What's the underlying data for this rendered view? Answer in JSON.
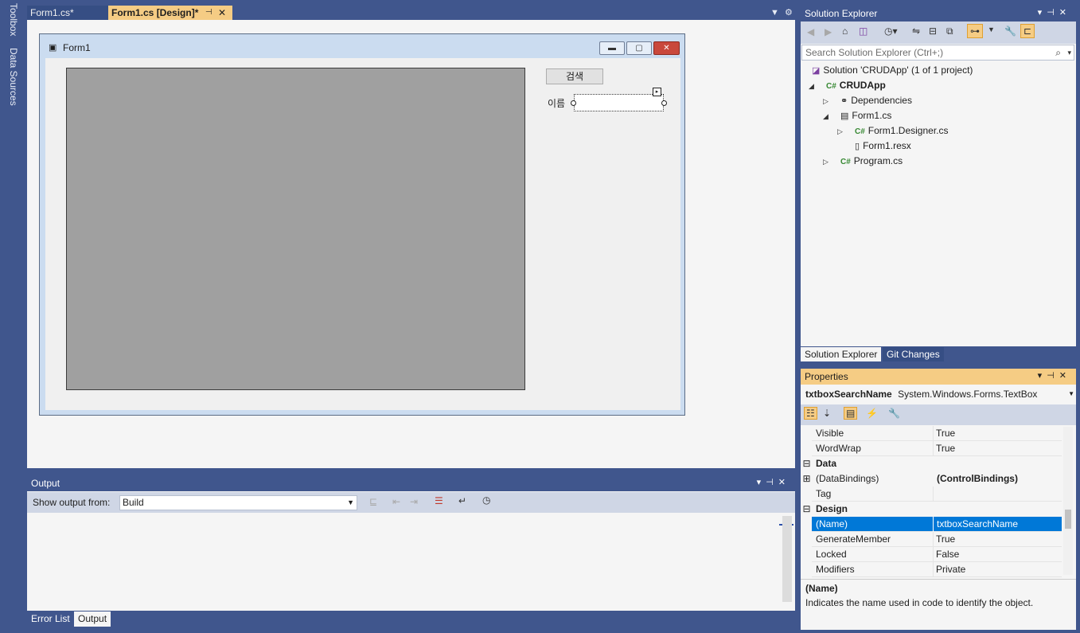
{
  "left_rail": {
    "toolbox": "Toolbox",
    "data_sources": "Data Sources"
  },
  "doc_tabs": [
    {
      "label": "Form1.cs*"
    },
    {
      "label": "Form1.cs [Design]*"
    }
  ],
  "designer": {
    "form_title": "Form1",
    "search_button": "검색",
    "name_label": "이름"
  },
  "output": {
    "title": "Output",
    "show_output_from": "Show output from:",
    "source": "Build"
  },
  "bottom_tabs": [
    "Error List",
    "Output"
  ],
  "solution_explorer": {
    "title": "Solution Explorer",
    "search_placeholder": "Search Solution Explorer (Ctrl+;)",
    "tree": [
      {
        "label": "Solution 'CRUDApp'   (1 of 1 project)"
      },
      {
        "label": "CRUDApp"
      },
      {
        "label": "Dependencies"
      },
      {
        "label": "Form1.cs"
      },
      {
        "label": "Form1.Designer.cs"
      },
      {
        "label": "Form1.resx"
      },
      {
        "label": "Program.cs"
      }
    ],
    "tabs": [
      "Solution Explorer",
      "Git Changes"
    ]
  },
  "properties": {
    "title": "Properties",
    "object_name": "txtboxSearchName",
    "object_type": "System.Windows.Forms.TextBox",
    "rows": [
      {
        "name": "Visible",
        "value": "True"
      },
      {
        "name": "WordWrap",
        "value": "True"
      },
      {
        "category": "Data"
      },
      {
        "name": "(DataBindings)",
        "value": "(ControlBindings)"
      },
      {
        "name": "Tag",
        "value": ""
      },
      {
        "category": "Design"
      },
      {
        "name": "(Name)",
        "value": "txtboxSearchName"
      },
      {
        "name": "GenerateMember",
        "value": "True"
      },
      {
        "name": "Locked",
        "value": "False"
      },
      {
        "name": "Modifiers",
        "value": "Private"
      }
    ],
    "description_title": "(Name)",
    "description_text": "Indicates the name used in code to identify the object."
  },
  "colors": {
    "chrome_blue": "#40568d",
    "tab_active": "#f5cc84",
    "selection": "#0078d7"
  }
}
